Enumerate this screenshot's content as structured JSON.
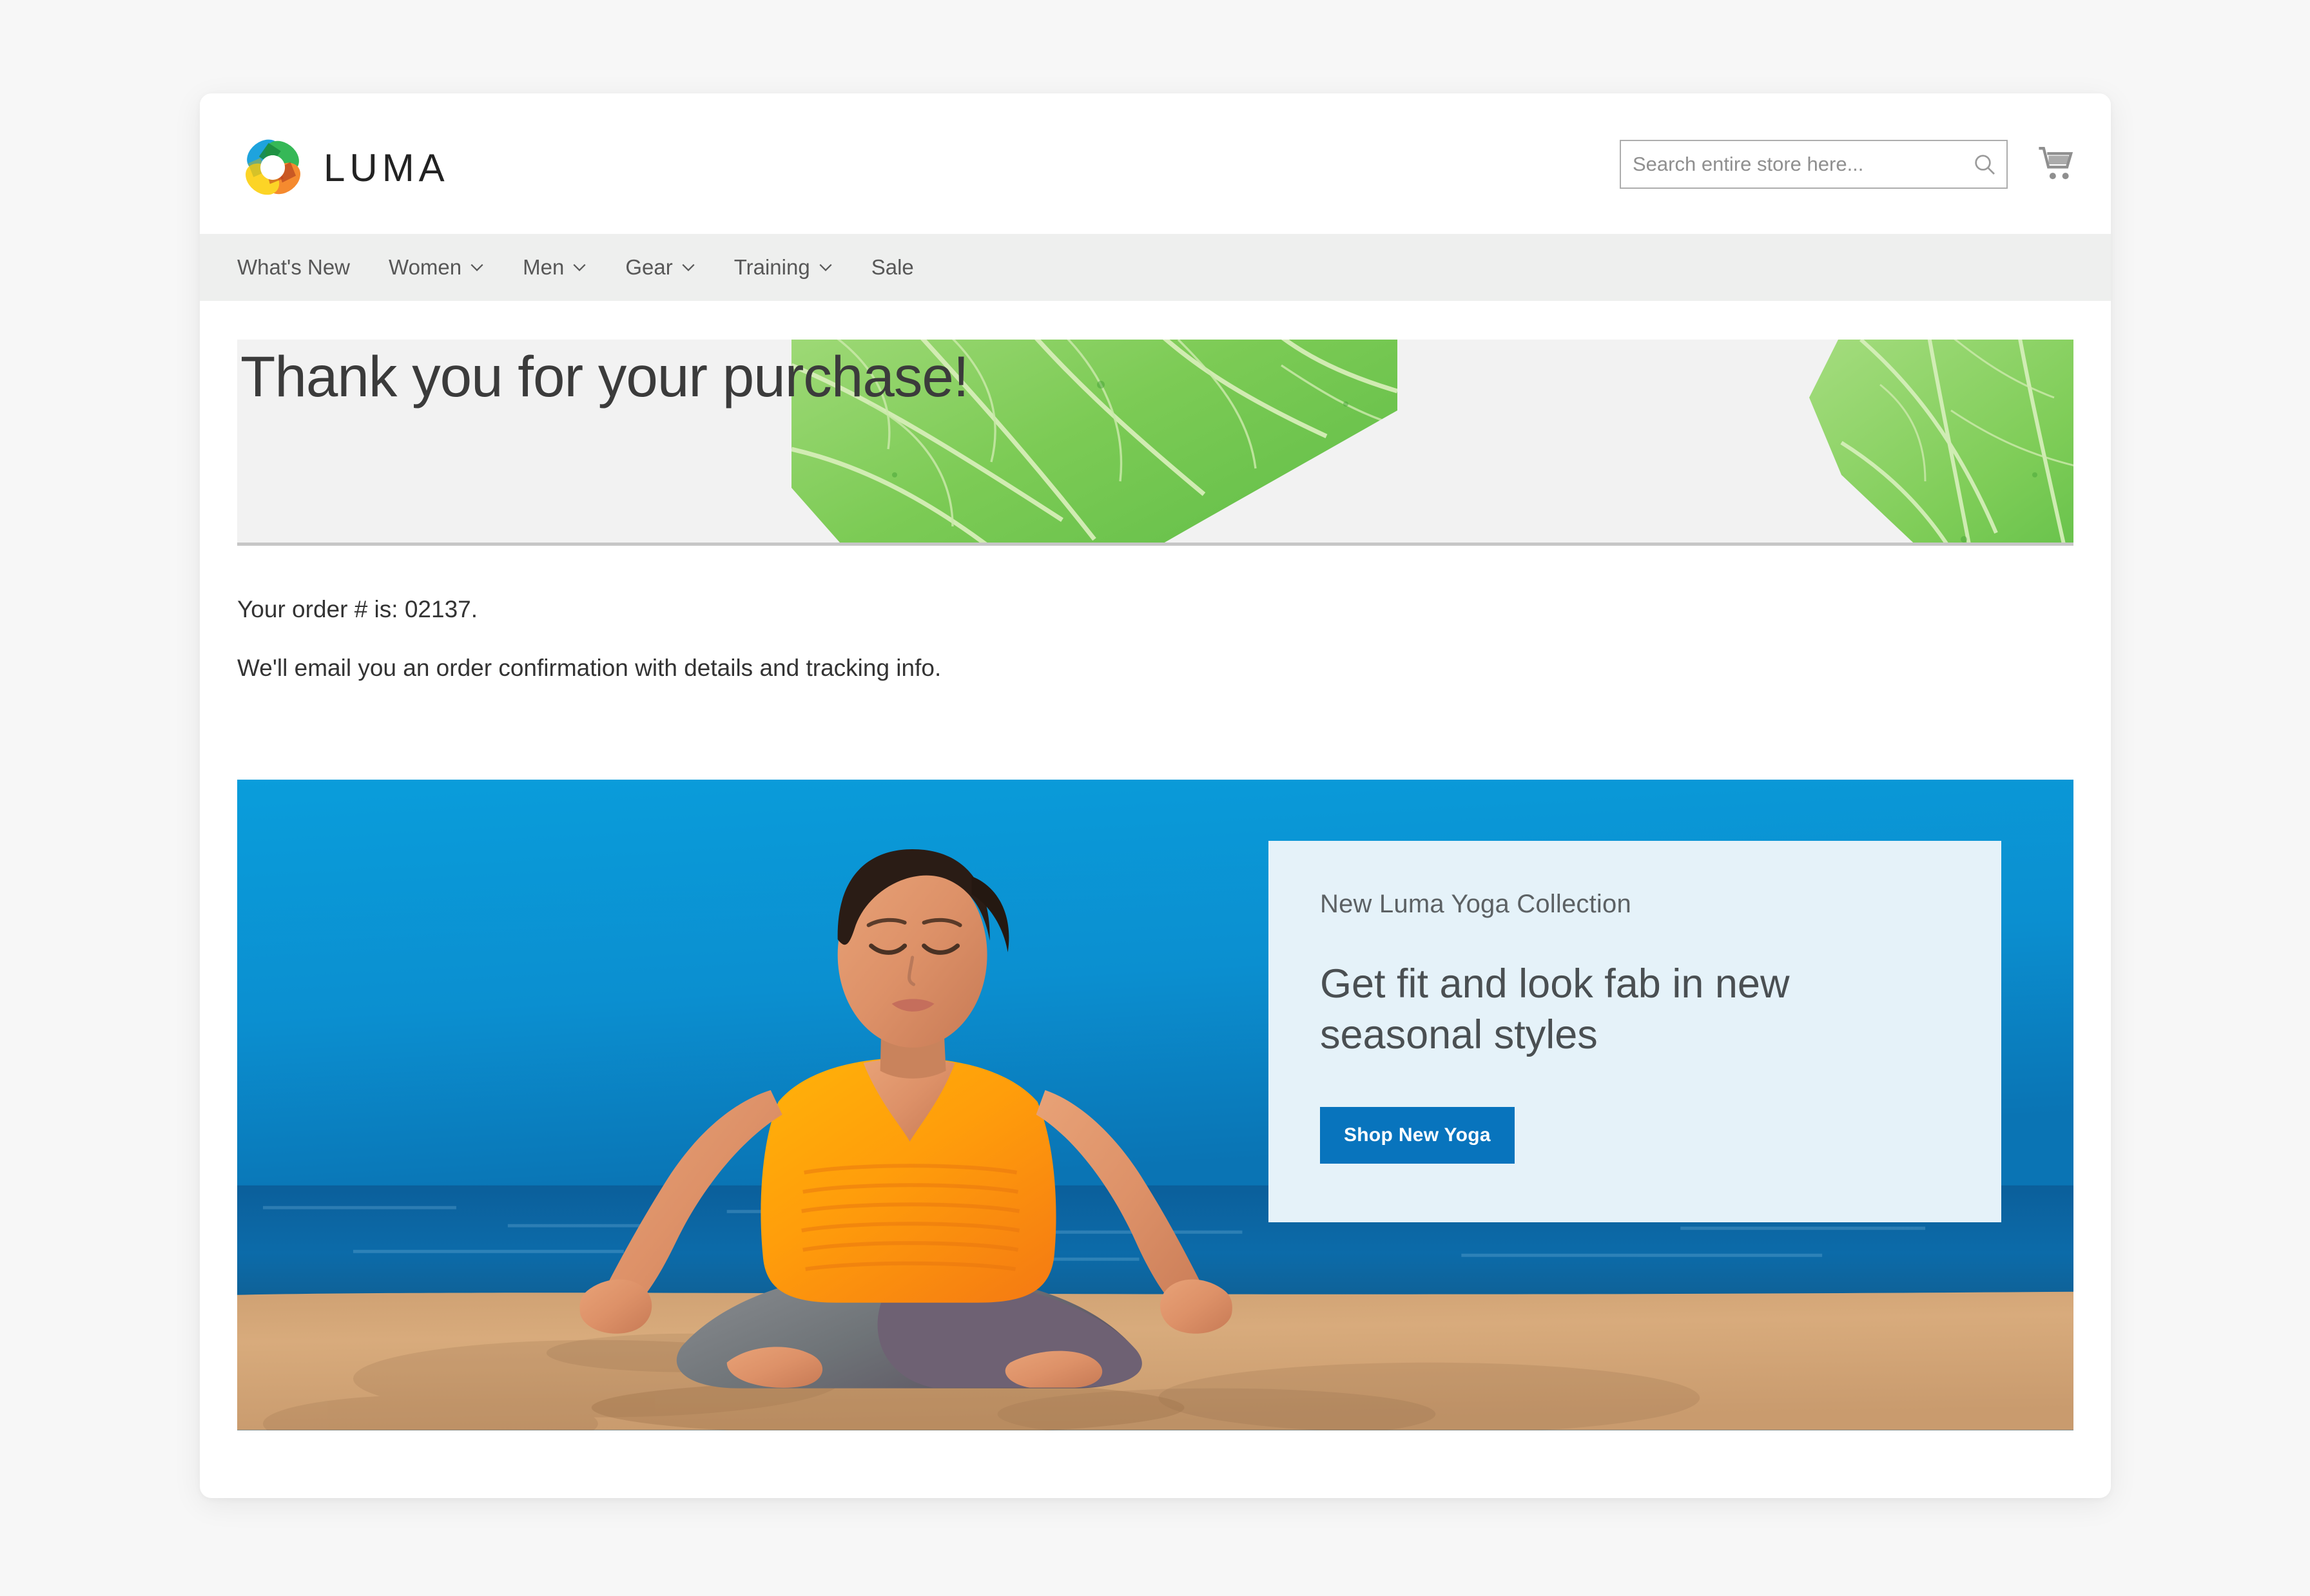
{
  "header": {
    "logo_text": "LUMA",
    "logo_icon": "luma-ring-logo",
    "search": {
      "placeholder": "Search entire store here...",
      "value": "",
      "icon": "search-icon"
    },
    "cart_icon": "shopping-cart-icon"
  },
  "nav": {
    "items": [
      {
        "label": "What's New",
        "has_caret": false
      },
      {
        "label": "Women",
        "has_caret": true
      },
      {
        "label": "Men",
        "has_caret": true
      },
      {
        "label": "Gear",
        "has_caret": true
      },
      {
        "label": "Training",
        "has_caret": true
      },
      {
        "label": "Sale",
        "has_caret": false
      }
    ],
    "caret_icon": "chevron-down-icon"
  },
  "hero": {
    "title": "Thank you for your purchase!",
    "background_image": "green-leaf-photo"
  },
  "order": {
    "number_line": "Your order # is: 02137.",
    "order_number": "02137",
    "email_line": "We'll email you an order confirmation with details and tracking info."
  },
  "promo": {
    "image": "woman-meditating-on-beach",
    "eyebrow": "New Luma Yoga Collection",
    "headline": "Get fit and look fab in new seasonal styles",
    "button_label": "Shop New Yoga"
  },
  "colors": {
    "accent_blue": "#0874bd",
    "panel_bg": "#e5f2f9",
    "nav_bg": "#eeefee",
    "hero_bg": "#f2f2f2",
    "divider": "#c6c6c6",
    "text_dark": "#333333",
    "text_muted": "#575757",
    "page_bg": "#f7f7f7"
  }
}
